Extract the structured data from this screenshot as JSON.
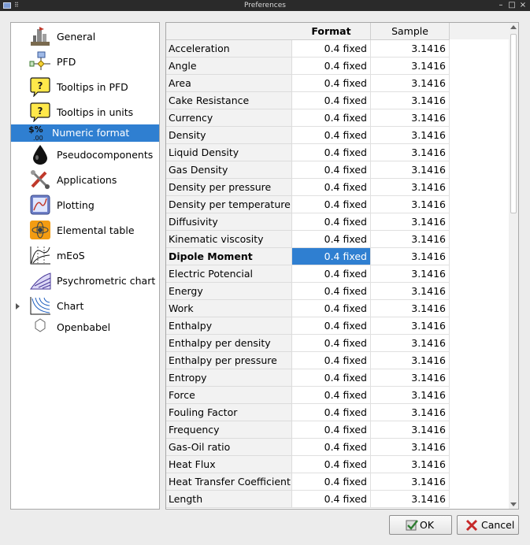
{
  "window": {
    "title": "Preferences"
  },
  "titlebar": {
    "minimize": "–",
    "restore": "□",
    "close": "×"
  },
  "sidebar": {
    "items": [
      {
        "label": "General",
        "icon": "general-icon"
      },
      {
        "label": "PFD",
        "icon": "pfd-icon"
      },
      {
        "label": "Tooltips in PFD",
        "icon": "tooltip-icon"
      },
      {
        "label": "Tooltips in units",
        "icon": "tooltip-icon"
      },
      {
        "label": "Numeric format",
        "icon": "numeric-format-icon",
        "selected": true
      },
      {
        "label": "Pseudocomponents",
        "icon": "drop-icon"
      },
      {
        "label": "Applications",
        "icon": "applications-icon"
      },
      {
        "label": "Plotting",
        "icon": "plotting-icon"
      },
      {
        "label": "Elemental table",
        "icon": "elemental-table-icon"
      },
      {
        "label": "mEoS",
        "icon": "meos-icon"
      },
      {
        "label": "Psychrometric chart",
        "icon": "psychrometric-icon"
      },
      {
        "label": "Chart",
        "icon": "chart-icon",
        "expandable": true
      },
      {
        "label": "Openbabel",
        "icon": "hexagon-icon"
      }
    ]
  },
  "numeric_icon_text": {
    "top": "$%",
    "bottom": ".00"
  },
  "tooltip_icon_glyph": "?",
  "table": {
    "headers": [
      "",
      "Format",
      "Sample"
    ],
    "rows": [
      {
        "name": "Acceleration",
        "format": "0.4 fixed",
        "sample": "3.1416"
      },
      {
        "name": "Angle",
        "format": "0.4 fixed",
        "sample": "3.1416"
      },
      {
        "name": "Area",
        "format": "0.4 fixed",
        "sample": "3.1416"
      },
      {
        "name": "Cake Resistance",
        "format": "0.4 fixed",
        "sample": "3.1416"
      },
      {
        "name": "Currency",
        "format": "0.4 fixed",
        "sample": "3.1416"
      },
      {
        "name": "Density",
        "format": "0.4 fixed",
        "sample": "3.1416"
      },
      {
        "name": "Liquid Density",
        "format": "0.4 fixed",
        "sample": "3.1416"
      },
      {
        "name": "Gas Density",
        "format": "0.4 fixed",
        "sample": "3.1416"
      },
      {
        "name": "Density per pressure",
        "format": "0.4 fixed",
        "sample": "3.1416"
      },
      {
        "name": "Density per temperature",
        "format": "0.4 fixed",
        "sample": "3.1416"
      },
      {
        "name": "Diffusivity",
        "format": "0.4 fixed",
        "sample": "3.1416"
      },
      {
        "name": "Kinematic viscosity",
        "format": "0.4 fixed",
        "sample": "3.1416"
      },
      {
        "name": "Dipole Moment",
        "format": "0.4 fixed",
        "sample": "3.1416",
        "selected": true
      },
      {
        "name": "Electric Potencial",
        "format": "0.4 fixed",
        "sample": "3.1416"
      },
      {
        "name": "Energy",
        "format": "0.4 fixed",
        "sample": "3.1416"
      },
      {
        "name": "Work",
        "format": "0.4 fixed",
        "sample": "3.1416"
      },
      {
        "name": "Enthalpy",
        "format": "0.4 fixed",
        "sample": "3.1416"
      },
      {
        "name": "Enthalpy per density",
        "format": "0.4 fixed",
        "sample": "3.1416"
      },
      {
        "name": "Enthalpy per pressure",
        "format": "0.4 fixed",
        "sample": "3.1416"
      },
      {
        "name": "Entropy",
        "format": "0.4 fixed",
        "sample": "3.1416"
      },
      {
        "name": "Force",
        "format": "0.4 fixed",
        "sample": "3.1416"
      },
      {
        "name": "Fouling Factor",
        "format": "0.4 fixed",
        "sample": "3.1416"
      },
      {
        "name": "Frequency",
        "format": "0.4 fixed",
        "sample": "3.1416"
      },
      {
        "name": "Gas-Oil ratio",
        "format": "0.4 fixed",
        "sample": "3.1416"
      },
      {
        "name": "Heat Flux",
        "format": "0.4 fixed",
        "sample": "3.1416"
      },
      {
        "name": "Heat Transfer Coefficient",
        "format": "0.4 fixed",
        "sample": "3.1416"
      },
      {
        "name": "Length",
        "format": "0.4 fixed",
        "sample": "3.1416"
      }
    ]
  },
  "buttons": {
    "ok": "OK",
    "cancel": "Cancel"
  },
  "colors": {
    "selection": "#2f7fd1",
    "ok_check": "#2e7d32",
    "cancel_x": "#c62828"
  }
}
